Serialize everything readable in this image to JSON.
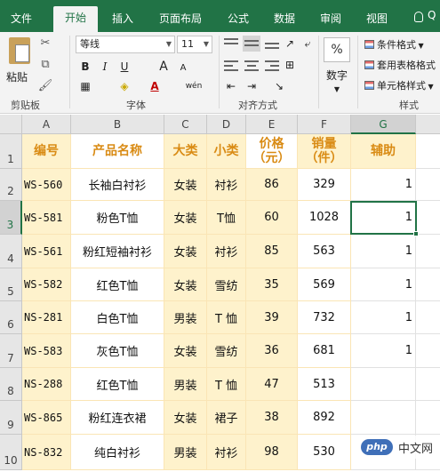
{
  "tabs": [
    "文件",
    "开始",
    "插入",
    "页面布局",
    "公式",
    "数据",
    "审阅",
    "视图"
  ],
  "active_tab": "开始",
  "tell_me": "Q",
  "ribbon": {
    "clipboard": {
      "paste": "粘贴",
      "group": "剪贴板"
    },
    "font": {
      "name": "等线",
      "size": "11",
      "bold": "B",
      "italic": "I",
      "underline": "U",
      "grow": "A",
      "shrink": "A",
      "phonetic": "wén",
      "group": "字体"
    },
    "alignment": {
      "group": "对齐方式"
    },
    "number": {
      "symbol": "%",
      "label": "数字"
    },
    "styles": {
      "cond_format": "条件格式",
      "table_format": "套用表格格式",
      "cell_styles": "单元格样式",
      "group": "样式"
    }
  },
  "columns": [
    "A",
    "B",
    "C",
    "D",
    "E",
    "F",
    "G"
  ],
  "selected_column": "G",
  "selected_row": "3",
  "header_row": [
    "编号",
    "产品名称",
    "大类",
    "小类",
    "价格\n（元）",
    "销量\n（件）",
    "辅助"
  ],
  "rows": [
    {
      "n": "1"
    },
    {
      "n": "2",
      "cells": [
        "WS-560",
        "长袖白衬衫",
        "女装",
        "衬衫",
        "86",
        "329",
        "1"
      ]
    },
    {
      "n": "3",
      "cells": [
        "WS-581",
        "粉色T恤",
        "女装",
        "T恤",
        "60",
        "1028",
        "1"
      ]
    },
    {
      "n": "4",
      "cells": [
        "WS-561",
        "粉红短袖衬衫",
        "女装",
        "衬衫",
        "85",
        "563",
        "1"
      ]
    },
    {
      "n": "5",
      "cells": [
        "WS-582",
        "红色T恤",
        "女装",
        "雪纺",
        "35",
        "569",
        "1"
      ]
    },
    {
      "n": "6",
      "cells": [
        "NS-281",
        "白色T恤",
        "男装",
        "T 恤",
        "39",
        "732",
        "1"
      ]
    },
    {
      "n": "7",
      "cells": [
        "WS-583",
        "灰色T恤",
        "女装",
        "雪纺",
        "36",
        "681",
        "1"
      ]
    },
    {
      "n": "8",
      "cells": [
        "NS-288",
        "红色T恤",
        "男装",
        "T 恤",
        "47",
        "513",
        ""
      ]
    },
    {
      "n": "9",
      "cells": [
        "WS-865",
        "粉红连衣裙",
        "女装",
        "裙子",
        "38",
        "892",
        ""
      ]
    },
    {
      "n": "10",
      "cells": [
        "NS-832",
        "纯白衬衫",
        "男装",
        "衬衫",
        "98",
        "530",
        ""
      ]
    }
  ],
  "watermark": {
    "logo": "php",
    "text": "中文网"
  }
}
